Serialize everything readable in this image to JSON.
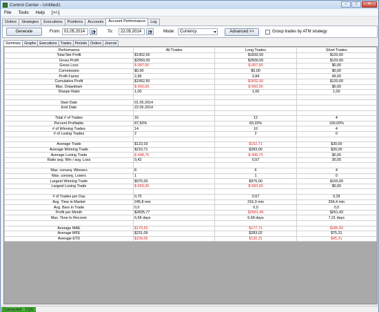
{
  "window": {
    "title": "Control Center - Untitled1"
  },
  "menu": [
    "File",
    "Tools",
    "Help",
    "[+/-]"
  ],
  "tabs": [
    "Orders",
    "Strategies",
    "Executions",
    "Positions",
    "Accounts",
    "Account Performance",
    "Log"
  ],
  "active_tab": "Account Performance",
  "toolbar": {
    "generate_label": "Generate",
    "from_label": "From:",
    "from_value": "01.05.2014",
    "to_label": "To:",
    "to_value": "22.05.2014",
    "mode_label": "Mode:",
    "mode_value": "Currency",
    "advanced_label": "Advanced >>",
    "group_checkbox_label": "Group trades by ATM strategy"
  },
  "subtabs": [
    "Summary",
    "Graphs",
    "Executions",
    "Trades",
    "Periods",
    "Orders",
    "Journal"
  ],
  "table": {
    "headers": [
      "Performance",
      "All Trades",
      "Long Trades",
      "Short Trades"
    ],
    "rows": [
      {
        "label": "Total Net Profit",
        "all": "$1952,50",
        "long": "$1832,50",
        "short": "$120,00"
      },
      {
        "label": "Gross Profit",
        "all": "$2950,00",
        "long": "$2830,00",
        "short": "$120,00"
      },
      {
        "label": "Gross Loss",
        "all": "$-997,50",
        "long": "$-997,50",
        "short": "$0,00",
        "neg_all": true,
        "neg_long": true
      },
      {
        "label": "Commission",
        "all": "$0,00",
        "long": "$0,00",
        "short": "$0,00"
      },
      {
        "label": "Profit Factor",
        "all": "2,96",
        "long": "2,84",
        "short": "99,00"
      },
      {
        "label": "Cumulative Profit",
        "all": "$1952,50",
        "long": "$1832,50",
        "short": "$120,00",
        "neg_long": true
      },
      {
        "label": "Max. Drawdown",
        "all": "$-560,00",
        "long": "$-560,00",
        "short": "$0,00",
        "neg_all": true,
        "neg_long": true
      },
      {
        "label": "Sharpe Ratio",
        "all": "1,00",
        "long": "1,00",
        "short": "1,00"
      },
      {
        "label": "",
        "all": "",
        "long": "",
        "short": ""
      },
      {
        "label": "Start Date",
        "all": "01.05.2014",
        "long": "",
        "short": ""
      },
      {
        "label": "End Date",
        "all": "22.05.2014",
        "long": "",
        "short": ""
      },
      {
        "label": "",
        "all": "",
        "long": "",
        "short": ""
      },
      {
        "label": "Total # of Trades",
        "all": "16",
        "long": "12",
        "short": "4"
      },
      {
        "label": "Percent Profitable",
        "all": "87,50%",
        "long": "83,33%",
        "short": "100,00%"
      },
      {
        "label": "# of Winning Trades",
        "all": "14",
        "long": "10",
        "short": "4"
      },
      {
        "label": "# of Losing Trades",
        "all": "2",
        "long": "2",
        "short": "0"
      },
      {
        "label": "",
        "all": "",
        "long": "",
        "short": ""
      },
      {
        "label": "Average Trade",
        "all": "$122,03",
        "long": "$152,71",
        "short": "$30,00",
        "neg_long": true
      },
      {
        "label": "Average Winning Trade",
        "all": "$210,71",
        "long": "$283,00",
        "short": "$30,00"
      },
      {
        "label": "Average Losing Trade",
        "all": "$-498,75",
        "long": "$-498,75",
        "short": "$0,00",
        "neg_all": true,
        "neg_long": true
      },
      {
        "label": "Ratio avg. Win / avg. Loss",
        "all": "0,42",
        "long": "0,57",
        "short": "30,00"
      },
      {
        "label": "",
        "all": "",
        "long": "",
        "short": ""
      },
      {
        "label": "Max. conseq. Winners",
        "all": "8",
        "long": "6",
        "short": "4"
      },
      {
        "label": "Max. conseq. Losers",
        "all": "1",
        "long": "1",
        "short": "0"
      },
      {
        "label": "Largest Winning Trade",
        "all": "$975,00",
        "long": "$975,00",
        "short": "$100,00"
      },
      {
        "label": "Largest Losing Trade",
        "all": "$-560,00",
        "long": "$-560,00",
        "short": "$0,00",
        "neg_all": true,
        "neg_long": true
      },
      {
        "label": "",
        "all": "",
        "long": "",
        "short": ""
      },
      {
        "label": "# of Trades per Day",
        "all": "0,76",
        "long": "0,57",
        "short": "0,29"
      },
      {
        "label": "Avg. Time in Market",
        "all": "245,8 min",
        "long": "216,3 min",
        "short": "334,4 min"
      },
      {
        "label": "Avg. Bars in Trade",
        "all": "0,0",
        "long": "0,0",
        "short": "0,0"
      },
      {
        "label": "Profit per Month",
        "all": "$2835,77",
        "long": "$2661,49",
        "short": "$261,43",
        "neg_long": true
      },
      {
        "label": "Max. Time to Recover",
        "all": "6,68 days",
        "long": "6,68 days",
        "short": "7,31 days"
      },
      {
        "label": "",
        "all": "",
        "long": "",
        "short": ""
      },
      {
        "label": "Average MAE",
        "all": "$179,53",
        "long": "$177,71",
        "short": "$185,00",
        "neg_all": true,
        "neg_long": true,
        "neg_short": true
      },
      {
        "label": "Average MFE",
        "all": "$231,09",
        "long": "$283,02",
        "short": "$75,31"
      },
      {
        "label": "Average ETD",
        "all": "$109,06",
        "long": "$130,31",
        "short": "$45,31",
        "neg_all": true,
        "neg_long": true,
        "neg_short": true
      }
    ]
  },
  "status": {
    "connection": "Connected - CQG"
  },
  "colors": {
    "negative": "#e02020",
    "connected": "#4cbb3c"
  }
}
